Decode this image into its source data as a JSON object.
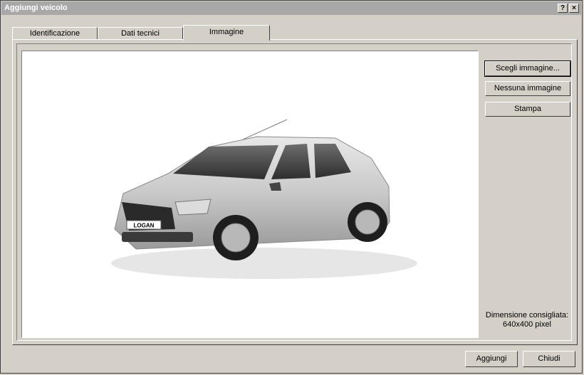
{
  "window": {
    "title": "Aggiungi veicolo",
    "help_label": "?",
    "close_label": "×"
  },
  "tabs": [
    {
      "label": "Identificazione"
    },
    {
      "label": "Dati tecnici"
    },
    {
      "label": "Immagine",
      "active": true
    }
  ],
  "image": {
    "plate_text": "LOGAN"
  },
  "side_buttons": {
    "choose": "Scegli immagine...",
    "none": "Nessuna immagine",
    "print": "Stampa"
  },
  "hint": {
    "line1": "Dimensione consigliata:",
    "line2": "640x400 pixel"
  },
  "footer": {
    "add": "Aggiungi",
    "close": "Chiudi"
  }
}
